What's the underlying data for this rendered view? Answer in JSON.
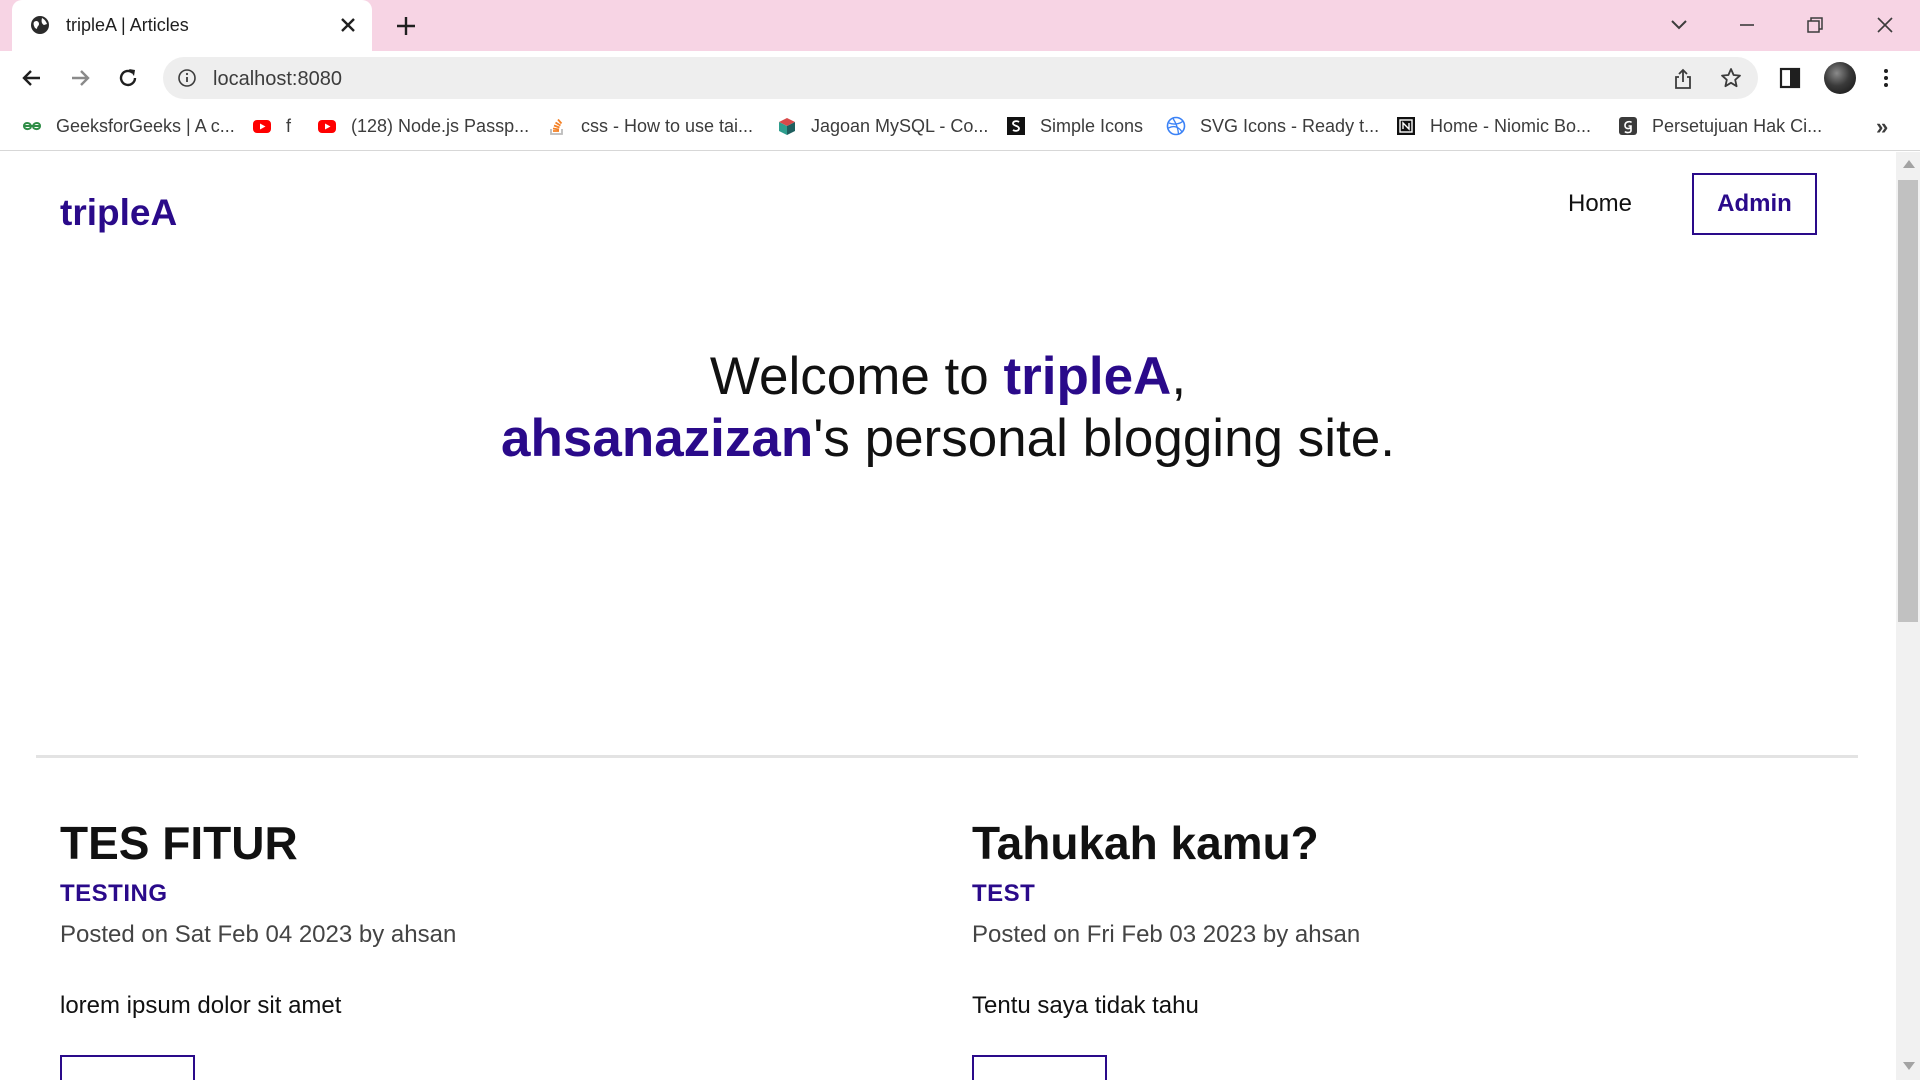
{
  "browser": {
    "tab": {
      "title": "tripleA | Articles",
      "favicon": "globe-icon"
    },
    "address_bar": {
      "url": "localhost:8080"
    },
    "bookmarks": [
      {
        "label": "GeeksforGeeks | A c...",
        "icon": "geeksforgeeks-icon"
      },
      {
        "label": "f",
        "icon": "youtube-icon"
      },
      {
        "label": "(128) Node.js Passp...",
        "icon": "youtube-icon"
      },
      {
        "label": "css - How to use tai...",
        "icon": "stackoverflow-icon"
      },
      {
        "label": "Jagoan MySQL - Co...",
        "icon": "cube-icon"
      },
      {
        "label": "Simple Icons",
        "icon": "simple-icons-icon"
      },
      {
        "label": "SVG Icons - Ready t...",
        "icon": "dribbble-icon"
      },
      {
        "label": "Home - Niomic Bo...",
        "icon": "niomic-icon"
      },
      {
        "label": "Persetujuan Hak Ci...",
        "icon": "g-icon"
      }
    ],
    "bookmarks_overflow": "»"
  },
  "site": {
    "logo": "tripleA",
    "nav": {
      "home": "Home",
      "admin": "Admin"
    },
    "hero": {
      "welcome": "Welcome to ",
      "brand": "tripleA",
      "comma": ",",
      "owner": "ahsanazizan",
      "rest": "'s personal blogging site."
    },
    "articles": [
      {
        "title": "TES FITUR",
        "tag": "TESTING",
        "meta": "Posted on Sat Feb 04 2023 by ahsan",
        "body": "lorem ipsum dolor sit amet"
      },
      {
        "title": "Tahukah kamu?",
        "tag": "TEST",
        "meta": "Posted on Fri Feb 03 2023 by ahsan",
        "body": "Tentu saya tidak tahu"
      }
    ]
  },
  "colors": {
    "accent": "#2a0a8a",
    "tabstrip": "#f7d4e4",
    "omnibox": "#eeeeee"
  }
}
